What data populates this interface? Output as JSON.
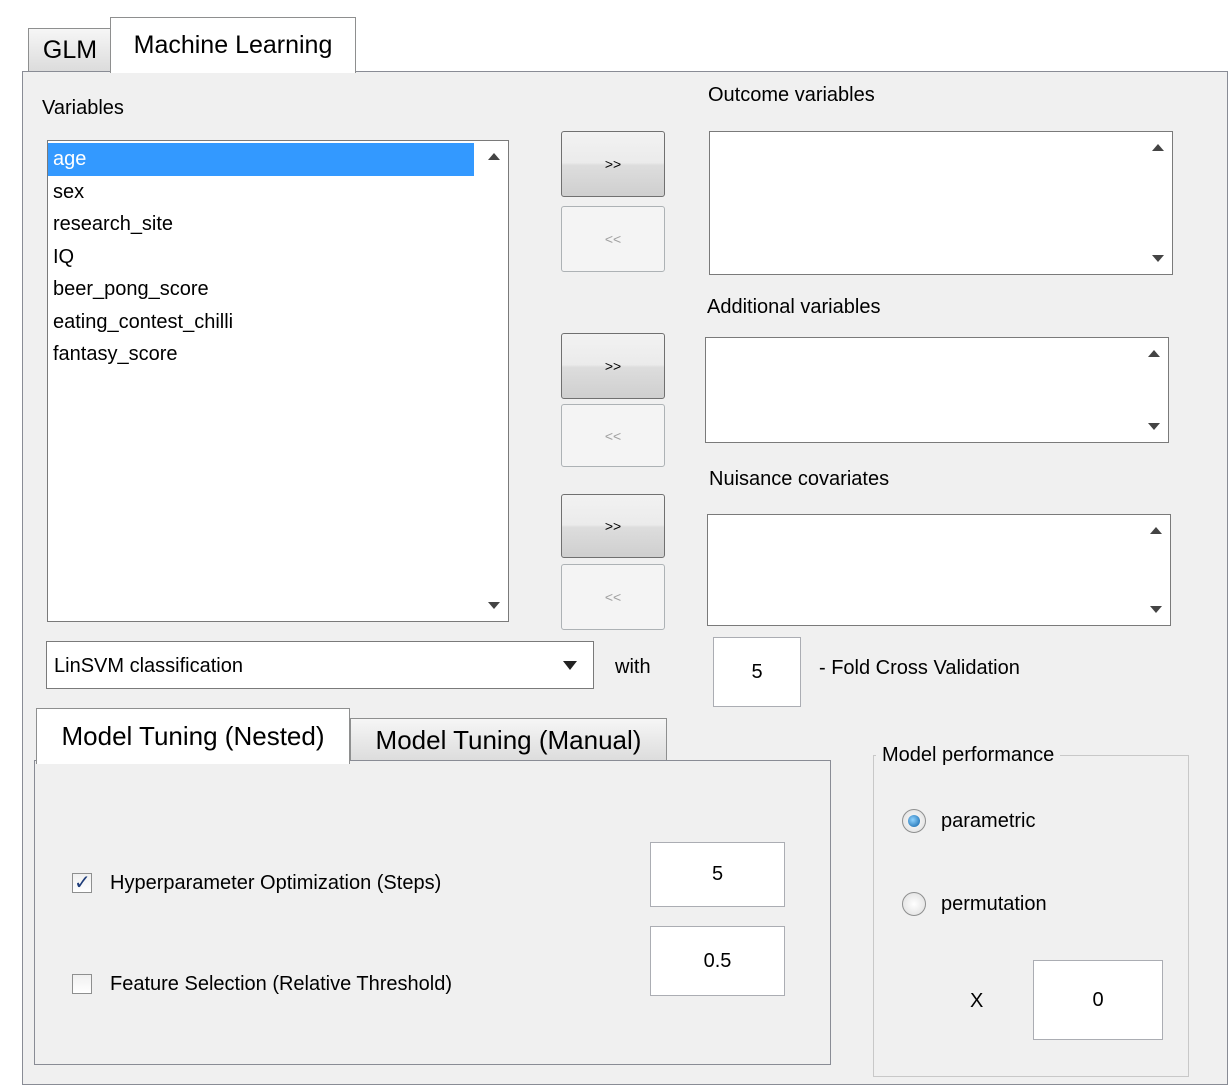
{
  "tabs": {
    "glm": "GLM",
    "ml": "Machine Learning"
  },
  "variables": {
    "label": "Variables",
    "items": [
      "age",
      "sex",
      "research_site",
      "IQ",
      "beer_pong_score",
      "eating_contest_chilli",
      "fantasy_score"
    ],
    "selected": "age"
  },
  "buttons": {
    "add": ">>",
    "remove": "<<"
  },
  "outcome": {
    "label": "Outcome variables"
  },
  "additional": {
    "label": "Additional variables"
  },
  "nuisance": {
    "label": "Nuisance covariates"
  },
  "method": {
    "selected": "LinSVM classification",
    "with_label": "with",
    "folds": "5",
    "cv_label": "- Fold Cross Validation"
  },
  "subtabs": {
    "nested": "Model Tuning (Nested)",
    "manual": "Model Tuning (Manual)"
  },
  "tuning": {
    "hyper": {
      "label": "Hyperparameter Optimization (Steps)",
      "checked": true,
      "value": "5"
    },
    "feature": {
      "label": "Feature Selection (Relative Threshold)",
      "checked": false,
      "value": "0.5"
    }
  },
  "performance": {
    "title": "Model performance",
    "parametric": "parametric",
    "permutation": "permutation",
    "selected": "parametric",
    "x_label": "X",
    "x_value": "0"
  },
  "icons": {
    "up": "scroll-up-arrow-icon",
    "down": "scroll-down-arrow-icon",
    "dropdown": "dropdown-arrow-icon",
    "check": "checkmark-icon"
  }
}
